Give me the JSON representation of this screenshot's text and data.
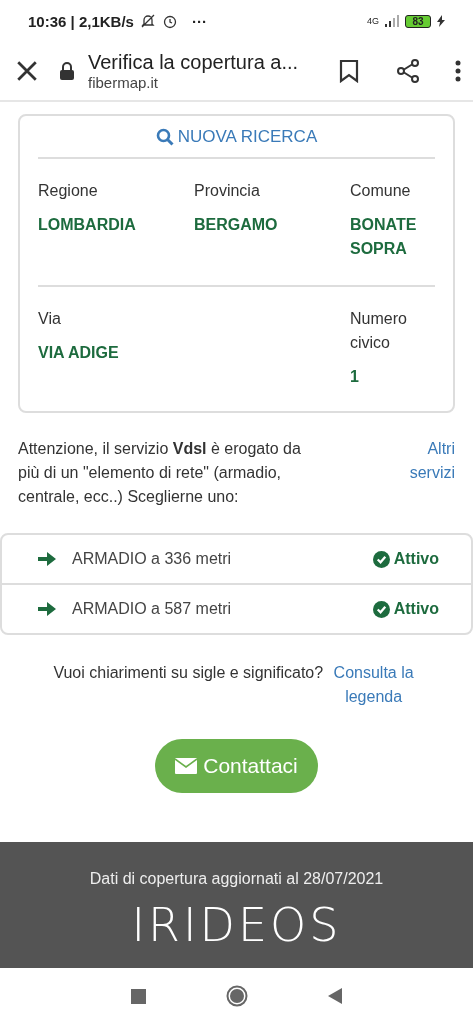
{
  "status_bar": {
    "time": "10:36",
    "separator": "|",
    "speed": "2,1KB/s",
    "more": "···",
    "network": "4G",
    "battery": "83"
  },
  "browser_bar": {
    "title": "Verifica la copertura a...",
    "url": "fibermap.it"
  },
  "search_card": {
    "new_search": "NUOVA RICERCA",
    "fields": [
      {
        "label": "Regione",
        "value": "LOMBARDIA"
      },
      {
        "label": "Provincia",
        "value": "BERGAMO"
      },
      {
        "label": "Comune",
        "value": "BONATE SOPRA"
      }
    ],
    "fields2": [
      {
        "label": "Via",
        "value": "VIA ADIGE"
      },
      {
        "label": "Numero civico",
        "value": "1"
      }
    ]
  },
  "notice": {
    "text": "Attenzione, il servizio **Vdsl** è erogato da più di un \"elemento di rete\" (armadio, centrale, ecc..) Sceglierne uno:",
    "link": "Altri servizi"
  },
  "elements": [
    {
      "label": "ARMADIO a 336 metri",
      "status": "Attivo",
      "active": true
    },
    {
      "label": "ARMADIO a 587 metri",
      "status": "Attivo",
      "active": true
    }
  ],
  "help": {
    "text": "Vuoi chiarimenti su sigle e significato?",
    "link": "Consulta la legenda"
  },
  "contact_button": "Contattaci",
  "footer": {
    "updated": "Dati di copertura aggiornati al 28/07/2021",
    "logo": "IRIDEOS"
  }
}
